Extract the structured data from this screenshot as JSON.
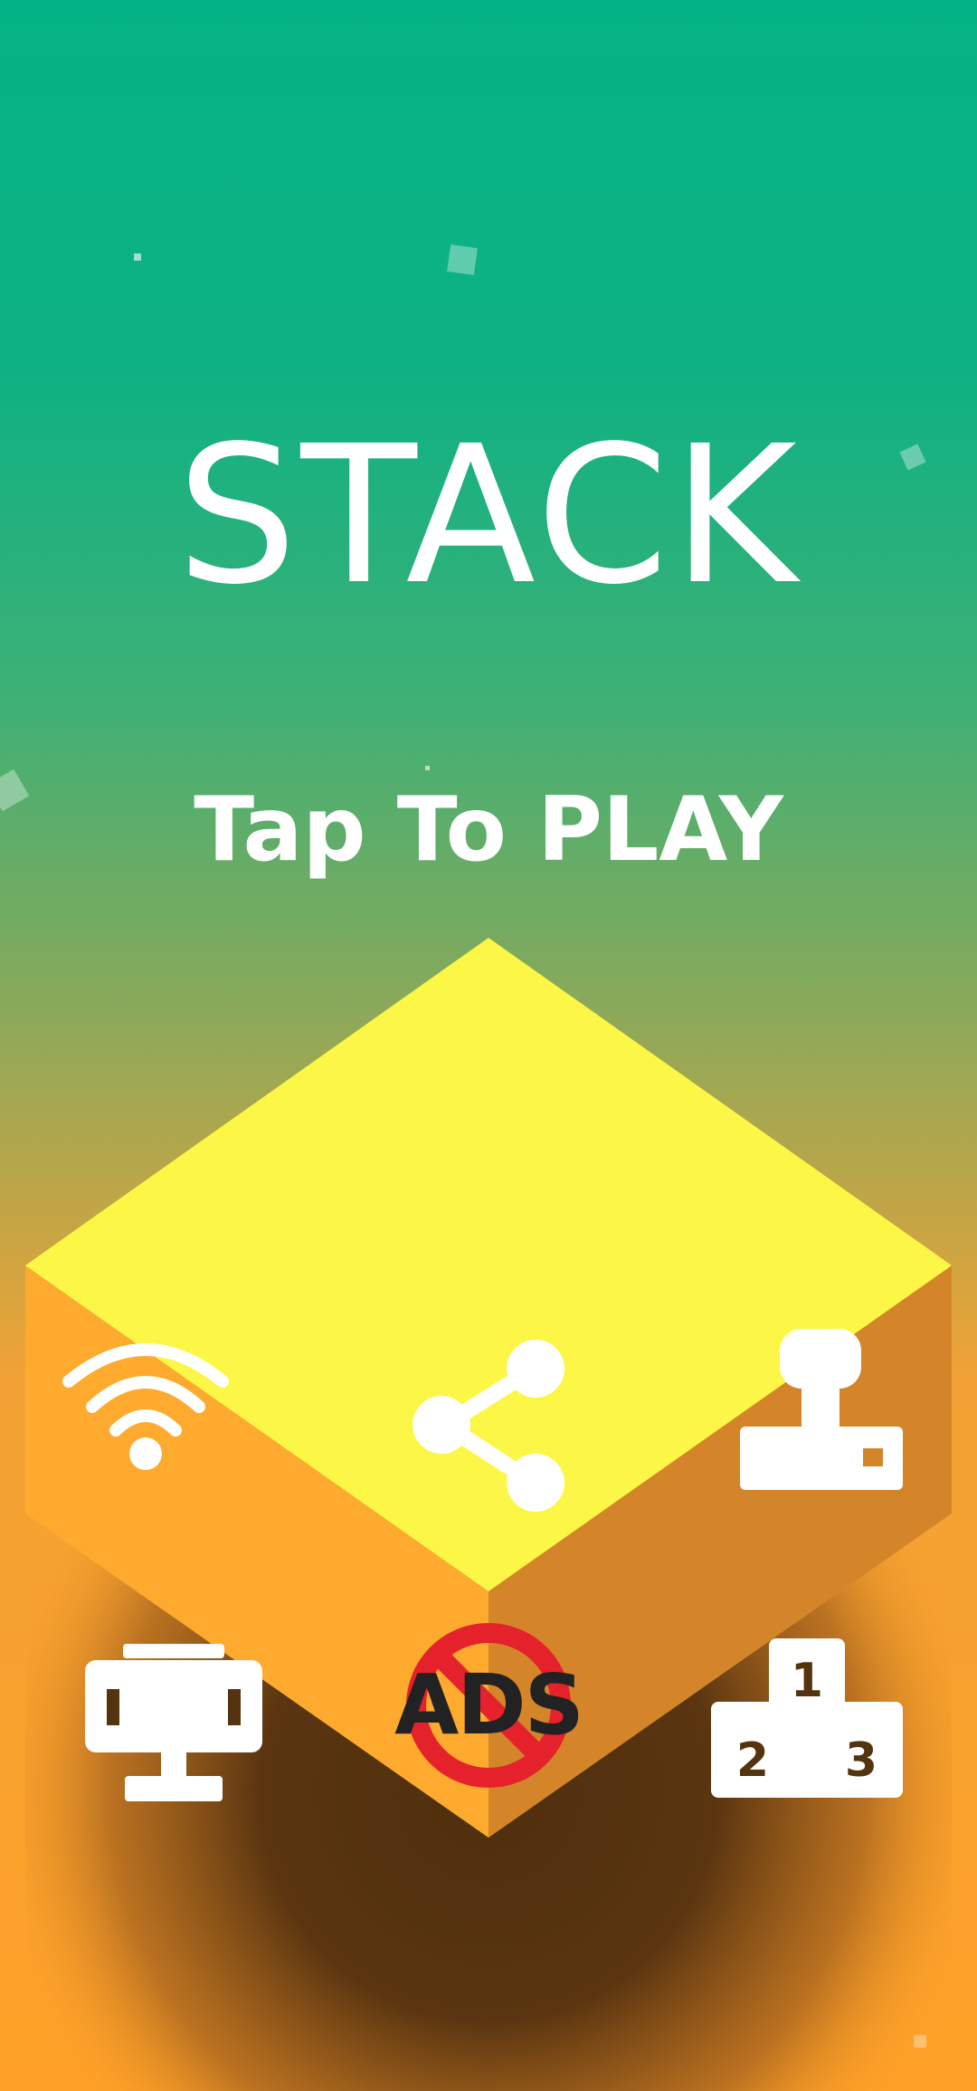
{
  "game": {
    "title": "STACK",
    "prompt": "Tap To PLAY"
  },
  "buttons": {
    "remove_ads_label": "ADS",
    "podium_first": "1",
    "podium_second": "2",
    "podium_third": "3"
  },
  "icons": {
    "top_left": "wifi-icon",
    "top_center": "share-icon",
    "top_right": "joystick-icon",
    "bottom_left": "trophy-icon",
    "bottom_center": "no-ads-icon",
    "bottom_right": "leaderboard-podium-icon"
  },
  "colors": {
    "background_top": "#04b385",
    "background_bottom": "#ffa128",
    "cube_top": "#fcf646",
    "cube_left": "#fdaa2e",
    "cube_right": "#d4852a",
    "cube_shadow": "#54330f",
    "no_ads_red": "#e5222c"
  }
}
